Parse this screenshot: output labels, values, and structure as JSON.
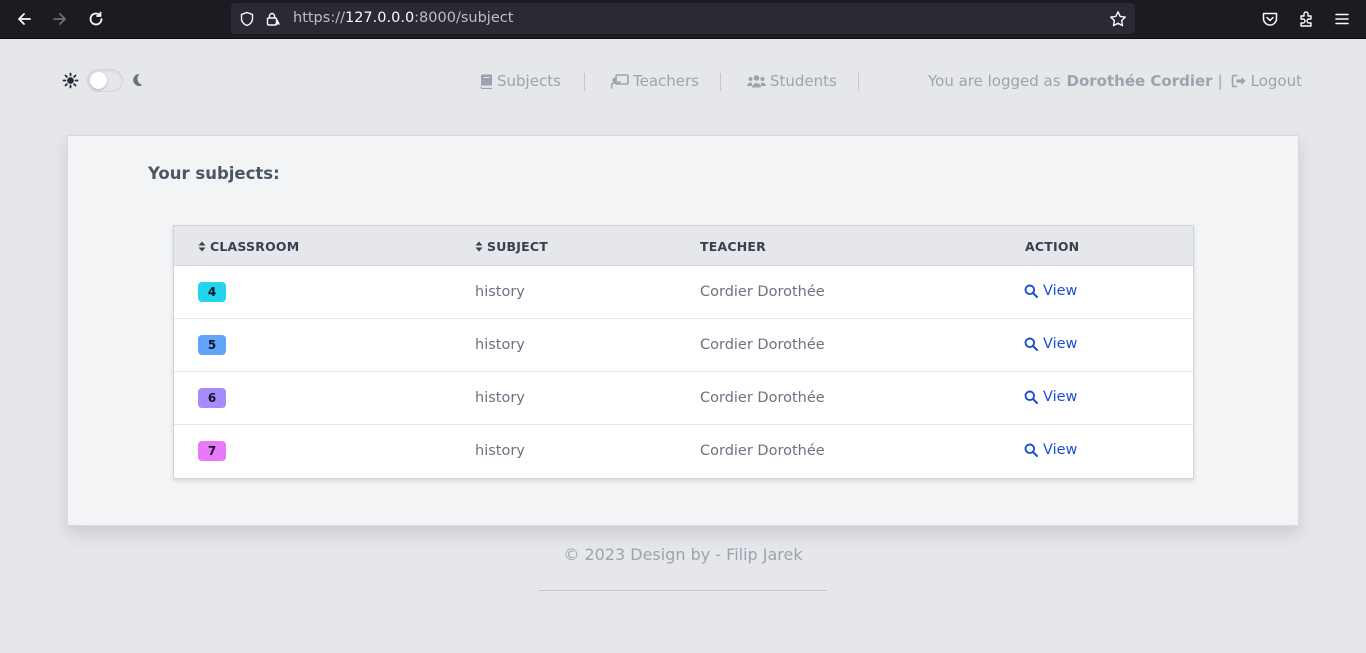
{
  "browser": {
    "url_prefix": "https://",
    "url_host": "127.0.0.0",
    "url_rest": ":8000/subject"
  },
  "theme": {
    "light_icon": "sun-icon",
    "dark_icon": "moon-icon",
    "mode": "light"
  },
  "nav": {
    "items": [
      {
        "label": "Subjects",
        "icon": "book-icon"
      },
      {
        "label": "Teachers",
        "icon": "chalkboard-teacher-icon"
      },
      {
        "label": "Students",
        "icon": "users-icon"
      }
    ]
  },
  "user": {
    "prefix": "You are logged as",
    "name": "Dorothée Cordier",
    "separator": "|",
    "logout_label": "Logout"
  },
  "main": {
    "title": "Your subjects:",
    "table": {
      "headers": {
        "classroom": "CLASSROOM",
        "subject": "SUBJECT",
        "teacher": "TEACHER",
        "action": "ACTION"
      },
      "rows": [
        {
          "classroom": "4",
          "color": "#22d3ee",
          "subject": "history",
          "teacher": "Cordier Dorothée",
          "action": "View"
        },
        {
          "classroom": "5",
          "color": "#60a5fa",
          "subject": "history",
          "teacher": "Cordier Dorothée",
          "action": "View"
        },
        {
          "classroom": "6",
          "color": "#a78bfa",
          "subject": "history",
          "teacher": "Cordier Dorothée",
          "action": "View"
        },
        {
          "classroom": "7",
          "color": "#e879f9",
          "subject": "history",
          "teacher": "Cordier Dorothée",
          "action": "View"
        }
      ]
    }
  },
  "footer": {
    "text": "© 2023 Design by - Filip Jarek"
  }
}
